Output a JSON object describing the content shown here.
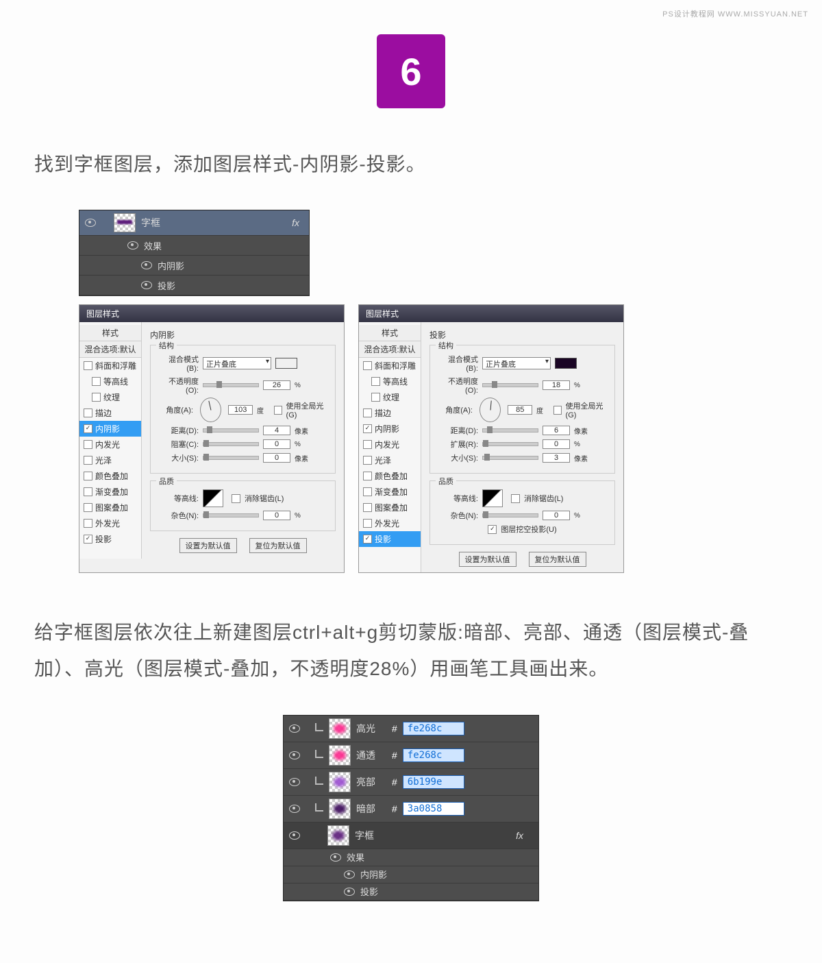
{
  "watermark": "PS设计教程网   WWW.MISSYUAN.NET",
  "step_number": "6",
  "paragraph1": "找到字框图层，添加图层样式-内阴影-投影。",
  "paragraph2": "给字框图层依次往上新建图层ctrl+alt+g剪切蒙版:暗部、亮部、通透（图层模式-叠加）、高光（图层模式-叠加，不透明度28%）用画笔工具画出来。",
  "layers_top": {
    "main_layer": "字框",
    "fx_label": "fx",
    "effects_label": "效果",
    "children": [
      "内阴影",
      "投影"
    ]
  },
  "dialog_title": "图层样式",
  "sidebar": {
    "header1": "样式",
    "header2": "混合选项:默认",
    "items": [
      {
        "label": "斜面和浮雕",
        "checked": false,
        "indent": 0
      },
      {
        "label": "等高线",
        "checked": false,
        "indent": 1
      },
      {
        "label": "纹理",
        "checked": false,
        "indent": 1
      },
      {
        "label": "描边",
        "checked": false,
        "indent": 0
      },
      {
        "label": "内阴影",
        "checked": true,
        "indent": 0
      },
      {
        "label": "内发光",
        "checked": false,
        "indent": 0
      },
      {
        "label": "光泽",
        "checked": false,
        "indent": 0
      },
      {
        "label": "颜色叠加",
        "checked": false,
        "indent": 0
      },
      {
        "label": "渐变叠加",
        "checked": false,
        "indent": 0
      },
      {
        "label": "图案叠加",
        "checked": false,
        "indent": 0
      },
      {
        "label": "外发光",
        "checked": false,
        "indent": 0
      },
      {
        "label": "投影",
        "checked": true,
        "indent": 0
      }
    ]
  },
  "inner_shadow": {
    "title": "内阴影",
    "sections": {
      "structure": "结构",
      "quality": "品质"
    },
    "labels": {
      "blend_mode": "混合模式(B):",
      "opacity": "不透明度(O):",
      "angle": "角度(A):",
      "distance": "距离(D):",
      "choke": "阻塞(C):",
      "size": "大小(S):",
      "contour": "等高线:",
      "antialias": "消除锯齿(L)",
      "noise": "杂色(N):",
      "global_light": "使用全局光(G)"
    },
    "blend_mode_value": "正片叠底",
    "swatch_color": "#4b0e63",
    "opacity": "26",
    "angle": "103",
    "distance": "4",
    "choke": "0",
    "size": "0",
    "noise": "0",
    "units": {
      "percent": "%",
      "px": "像素",
      "deg": "度"
    }
  },
  "drop_shadow": {
    "title": "投影",
    "sections": {
      "structure": "结构",
      "quality": "品质"
    },
    "labels": {
      "blend_mode": "混合模式(B):",
      "opacity": "不透明度(O):",
      "angle": "角度(A):",
      "distance": "距离(D):",
      "spread": "扩展(R):",
      "size": "大小(S):",
      "contour": "等高线:",
      "antialias": "消除锯齿(L)",
      "noise": "杂色(N):",
      "knockout": "图层挖空投影(U)",
      "global_light": "使用全局光(G)"
    },
    "blend_mode_value": "正片叠底",
    "swatch_color": "#1a0524",
    "opacity": "18",
    "angle": "85",
    "distance": "6",
    "spread": "0",
    "size": "3",
    "noise": "0",
    "units": {
      "percent": "%",
      "px": "像素",
      "deg": "度"
    }
  },
  "buttons": {
    "default": "设置为默认值",
    "reset": "复位为默认值"
  },
  "layers_bottom": {
    "rows": [
      {
        "name": "高光",
        "hex": "fe268c",
        "thumb_color": "#fe268c"
      },
      {
        "name": "通透",
        "hex": "fe268c",
        "thumb_color": "#fe268c"
      },
      {
        "name": "亮部",
        "hex": "6b199e",
        "thumb_color": "#9b4dd1"
      },
      {
        "name": "暗部",
        "hex": "3a0858",
        "thumb_color": "#3a0858"
      }
    ],
    "main_layer": "字框",
    "fx_label": "fx",
    "effects_label": "效果",
    "children": [
      "内阴影",
      "投影"
    ]
  }
}
